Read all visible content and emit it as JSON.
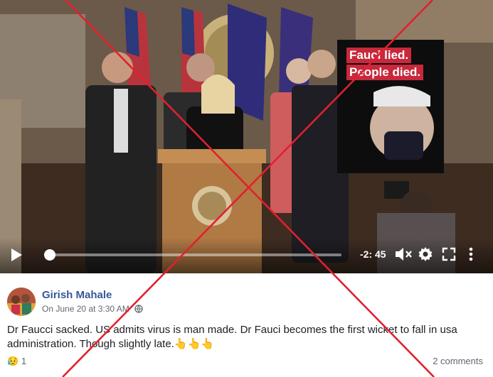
{
  "video": {
    "poster_line1": "Fauci lied.",
    "poster_line2": "People died.",
    "time_remaining": "-2: 45",
    "progress_fraction": 0.02
  },
  "post": {
    "author": "Girish Mahale",
    "timestamp": "On June 20 at 3:30 AM",
    "text": "Dr Faucci sacked. US admits virus is man made. Dr Fauci becomes the first wicket to fall in usa administration. Though slightly late.",
    "emoji_text": "👆👆👆",
    "reaction_emoji": "😥",
    "reaction_count": "1",
    "comments": "2 comments"
  },
  "icons": [
    "play-icon",
    "volume-muted-icon",
    "settings-gear-icon",
    "fullscreen-icon",
    "more-icon",
    "globe-icon"
  ],
  "colors": {
    "author_link": "#385898",
    "poster_red": "#c8283b",
    "cross_red": "#e0212f"
  }
}
